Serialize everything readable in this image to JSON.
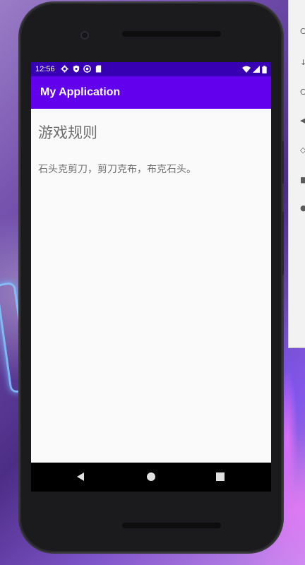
{
  "status_bar": {
    "time": "12:56",
    "left_icons": [
      "settings-gear-icon",
      "shield-icon",
      "sync-circle-icon",
      "sd-card-icon"
    ],
    "right_icons": [
      "wifi-icon",
      "signal-icon",
      "battery-icon"
    ]
  },
  "app_bar": {
    "title": "My Application",
    "color": "#6200ee",
    "status_color": "#3700b3"
  },
  "content": {
    "heading": "游戏规则",
    "rules_text": "石头克剪刀，剪刀克布，布克石头。"
  },
  "nav_bar": {
    "buttons": [
      "back-icon",
      "home-icon",
      "recents-icon"
    ]
  }
}
